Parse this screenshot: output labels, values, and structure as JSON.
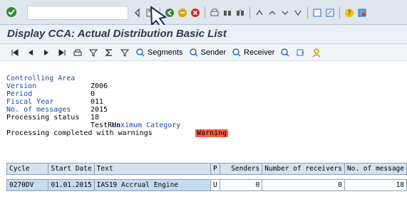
{
  "title": "Display CCA: Actual Distribution Basic List",
  "toolbar": {
    "segments": "Segments",
    "sender": "Sender",
    "receiver": "Receiver"
  },
  "report": {
    "controlling_area_label": "Controlling Area",
    "controlling_area_value": "Z006",
    "version_label": "Version",
    "version_value": "0",
    "period_label": "Period",
    "period_value": "011",
    "fiscal_year_label": "Fiscal Year",
    "fiscal_year_value": "2015",
    "no_messages_label": "No. of messages",
    "no_messages_value": "18",
    "max_category_label": "Maximum Category",
    "max_category_value": "Warning",
    "processing_status_label": "Processing status",
    "processing_status_value": "TestRun",
    "processing_result": "Processing completed with warnings"
  },
  "table": {
    "headers": [
      "Cycle",
      "Start Date",
      "Text",
      "P",
      "Senders",
      "Number of receivers",
      "No. of message"
    ],
    "row": {
      "cycle": "0270DV",
      "start_date": "01.01.2015",
      "text": "IAS19 Accrual Engine",
      "p": "U",
      "senders": "0",
      "receivers": "0",
      "messages": "18"
    }
  },
  "colors": {
    "warning_bg": "#ff5b45",
    "label_blue": "#2046a1"
  }
}
